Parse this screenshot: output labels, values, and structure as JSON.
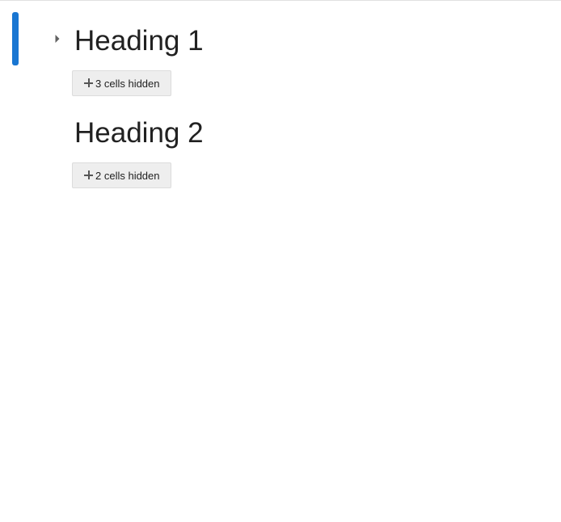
{
  "colors": {
    "active_indicator": "#1976d2",
    "button_background": "#eeeeee",
    "text": "#212121"
  },
  "cells": [
    {
      "heading": "Heading 1",
      "hidden_button_label": "3 cells hidden",
      "selected": true,
      "collapse_icon": "caret-right-icon"
    },
    {
      "heading": "Heading 2",
      "hidden_button_label": "2 cells hidden",
      "selected": false
    }
  ],
  "icons": {
    "expand": "plus-icon"
  }
}
